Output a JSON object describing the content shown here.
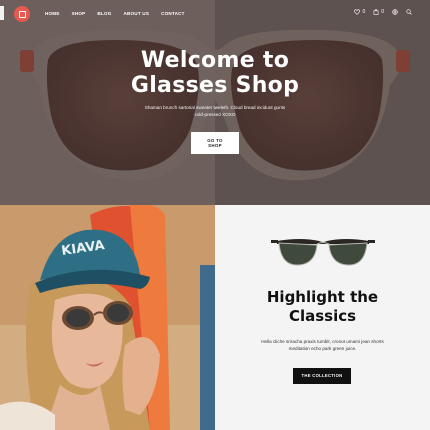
{
  "nav": {
    "items": [
      "HOME",
      "SHOP",
      "BLOG",
      "ABOUT US",
      "CONTACT"
    ]
  },
  "toolbar": {
    "wishlist_count": "0",
    "cart_count": "0",
    "icons": [
      "heart-icon",
      "bag-icon",
      "account-icon",
      "search-icon"
    ]
  },
  "hero": {
    "title_line1": "Welcome to",
    "title_line2": "Glasses Shop",
    "subtitle": "Shaman brunch sartorial sweater tweleth. Cloud bread incidunt gunts cold-pressed XOXO",
    "cta": "GO TO SHOP"
  },
  "feature": {
    "title_line1": "Highlight the",
    "title_line2": "Classics",
    "text": "Hella cliche sriracha praxis tumblr, cronut umami jean shorts meditation echo park green juice.",
    "cta": "THE COLLECTION"
  },
  "colors": {
    "brand": "#e85a4f",
    "hero_bg": "#786b67",
    "feature_bg": "#f4f4f4"
  }
}
